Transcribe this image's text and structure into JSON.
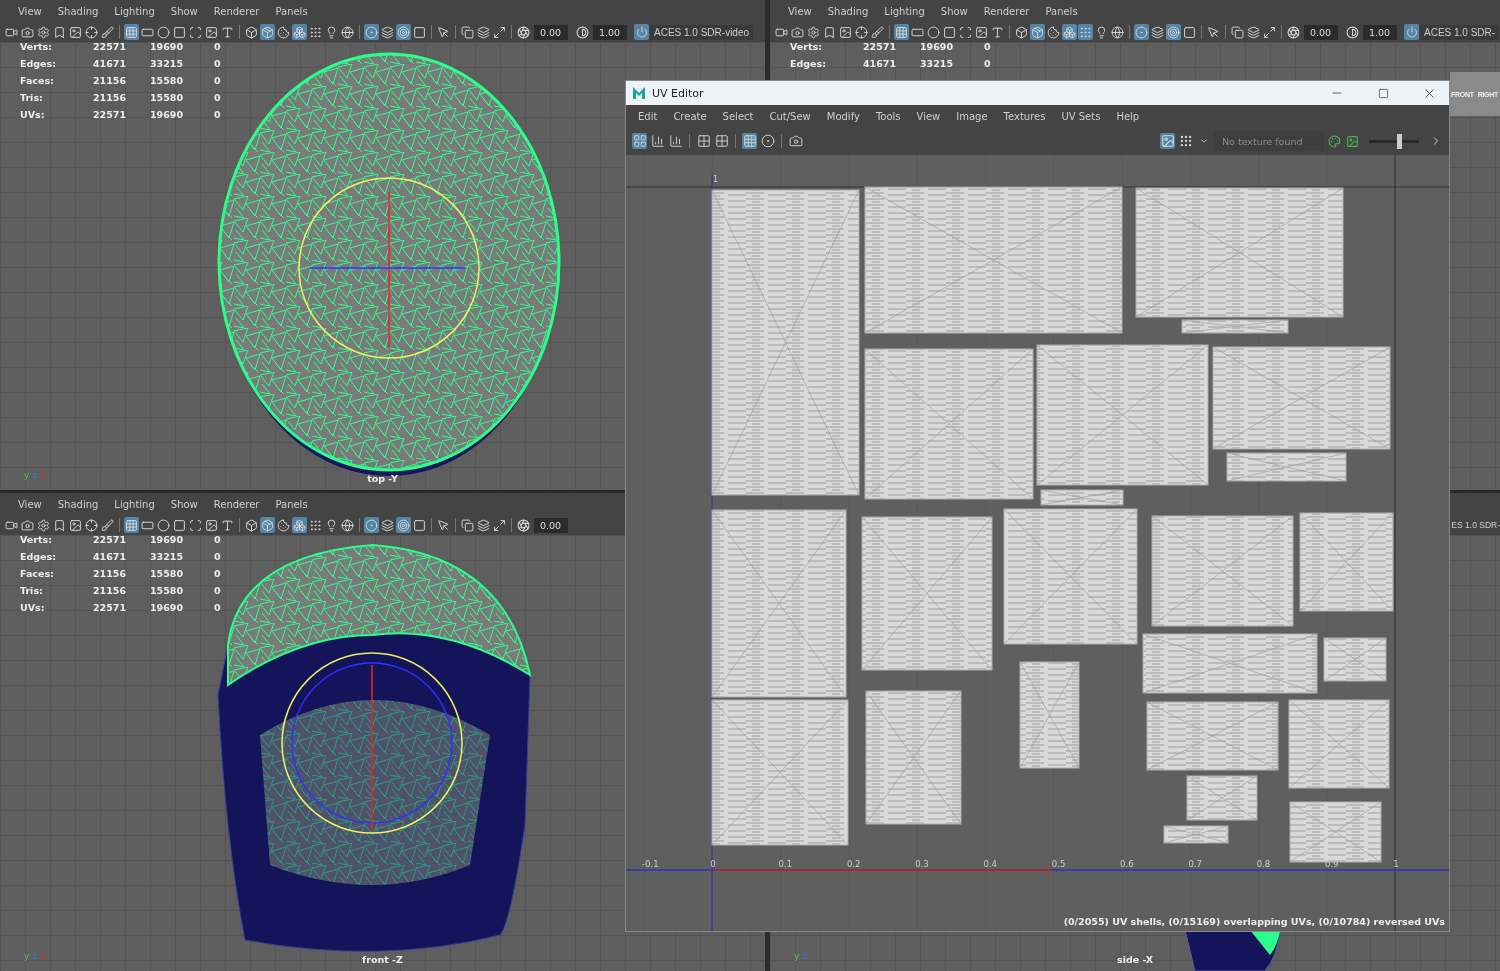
{
  "viewports": [
    {
      "kind": "top",
      "menus": [
        "View",
        "Shading",
        "Lighting",
        "Show",
        "Renderer",
        "Panels"
      ],
      "tools": [
        {
          "on": false
        },
        {
          "on": false
        },
        {
          "on": false
        },
        {
          "on": false
        },
        {
          "on": false
        },
        {
          "on": false
        },
        {
          "on": false
        },
        {
          "on": true
        },
        {
          "on": false
        },
        {
          "on": false
        },
        {
          "on": false
        },
        {
          "on": false
        },
        {
          "on": false
        },
        {
          "on": false
        },
        {
          "on": false
        },
        {
          "on": true
        },
        {
          "on": false
        },
        {
          "on": true
        },
        {
          "on": false
        },
        {
          "on": false
        },
        {
          "on": false
        },
        {
          "on": true
        },
        {
          "on": false
        },
        {
          "on": true
        },
        {
          "on": false
        },
        {
          "on": false
        },
        {
          "on": false
        },
        {
          "on": false
        },
        {
          "on": false
        }
      ],
      "fields": [
        "0.00",
        "1.00"
      ],
      "color_space": "ACES 1.0 SDR-video",
      "stats": [
        {
          "label": "Verts:",
          "values": [
            "22571",
            "19690",
            "0"
          ]
        },
        {
          "label": "Edges:",
          "values": [
            "41671",
            "33215",
            "0"
          ]
        },
        {
          "label": "Faces:",
          "values": [
            "21156",
            "15580",
            "0"
          ]
        },
        {
          "label": "Tris:",
          "values": [
            "21156",
            "15580",
            "0"
          ]
        },
        {
          "label": "UVs:",
          "values": [
            "22571",
            "19690",
            "0"
          ]
        }
      ],
      "camera": "top -Y",
      "axes": [
        "y",
        "z",
        "x"
      ]
    },
    {
      "kind": "persp",
      "menus": [
        "View",
        "Shading",
        "Lighting",
        "Show",
        "Renderer",
        "Panels"
      ],
      "tools": [
        {
          "on": false
        },
        {
          "on": false
        },
        {
          "on": false
        },
        {
          "on": false
        },
        {
          "on": false
        },
        {
          "on": false
        },
        {
          "on": false
        },
        {
          "on": true
        },
        {
          "on": false
        },
        {
          "on": false
        },
        {
          "on": false
        },
        {
          "on": false
        },
        {
          "on": false
        },
        {
          "on": false
        },
        {
          "on": false
        },
        {
          "on": true
        },
        {
          "on": false
        },
        {
          "on": true
        },
        {
          "on": true
        },
        {
          "on": false
        },
        {
          "on": false
        },
        {
          "on": true
        },
        {
          "on": false
        },
        {
          "on": true
        },
        {
          "on": false
        },
        {
          "on": false
        },
        {
          "on": false
        },
        {
          "on": false
        },
        {
          "on": false
        }
      ],
      "fields": [
        "0.00",
        "1.00"
      ],
      "color_space": "ACES 1.0 SDR-",
      "stats": [
        {
          "label": "Verts:",
          "values": [
            "22571",
            "19690",
            "0"
          ]
        },
        {
          "label": "Edges:",
          "values": [
            "41671",
            "33215",
            "0"
          ]
        }
      ],
      "view_cube": [
        "FRONT",
        "RIGHT"
      ]
    },
    {
      "kind": "front",
      "menus": [
        "View",
        "Shading",
        "Lighting",
        "Show",
        "Renderer",
        "Panels"
      ],
      "tools": [
        {
          "on": false
        },
        {
          "on": false
        },
        {
          "on": false
        },
        {
          "on": false
        },
        {
          "on": false
        },
        {
          "on": false
        },
        {
          "on": false
        },
        {
          "on": true
        },
        {
          "on": false
        },
        {
          "on": false
        },
        {
          "on": false
        },
        {
          "on": false
        },
        {
          "on": false
        },
        {
          "on": false
        },
        {
          "on": false
        },
        {
          "on": true
        },
        {
          "on": false
        },
        {
          "on": true
        },
        {
          "on": false
        },
        {
          "on": false
        },
        {
          "on": false
        },
        {
          "on": true
        },
        {
          "on": false
        },
        {
          "on": true
        },
        {
          "on": false
        },
        {
          "on": false
        },
        {
          "on": false
        },
        {
          "on": false
        },
        {
          "on": false
        }
      ],
      "fields": [
        "0.00"
      ],
      "stats": [
        {
          "label": "Verts:",
          "values": [
            "22571",
            "19690",
            "0"
          ]
        },
        {
          "label": "Edges:",
          "values": [
            "41671",
            "33215",
            "0"
          ]
        },
        {
          "label": "Faces:",
          "values": [
            "21156",
            "15580",
            "0"
          ]
        },
        {
          "label": "Tris:",
          "values": [
            "21156",
            "15580",
            "0"
          ]
        },
        {
          "label": "UVs:",
          "values": [
            "22571",
            "19690",
            "0"
          ]
        }
      ],
      "camera": "front -Z",
      "axes": [
        "y",
        "z",
        "x"
      ]
    },
    {
      "kind": "side",
      "color_space": "ES 1.0 SDR-",
      "camera": "side -X",
      "axes": [
        "y",
        "z"
      ]
    }
  ],
  "uv_editor": {
    "title": "UV Editor",
    "menus": [
      "Edit",
      "Create",
      "Select",
      "Cut/Sew",
      "Modify",
      "Tools",
      "View",
      "Image",
      "Textures",
      "UV Sets",
      "Help"
    ],
    "tools": [
      {
        "on": true
      },
      {
        "on": false
      },
      {
        "on": false
      },
      {
        "on": false
      },
      {
        "on": false
      },
      {
        "on": true
      },
      {
        "on": false
      },
      {
        "on": false
      }
    ],
    "right_tools": [
      {
        "on": true
      },
      {
        "on": false
      }
    ],
    "texture_placeholder": "No texture found",
    "exposure": {
      "level": 0.6
    },
    "v_label": "1",
    "u_ticks": [
      "-0.1",
      "0",
      "0.1",
      "0.2",
      "0.3",
      "0.4",
      "0.5",
      "0.6",
      "0.7",
      "0.8",
      "0.9",
      "1"
    ],
    "status": "(0/2055) UV shells, (0/15169) overlapping UVs, (0/10784) reversed UVs"
  }
}
